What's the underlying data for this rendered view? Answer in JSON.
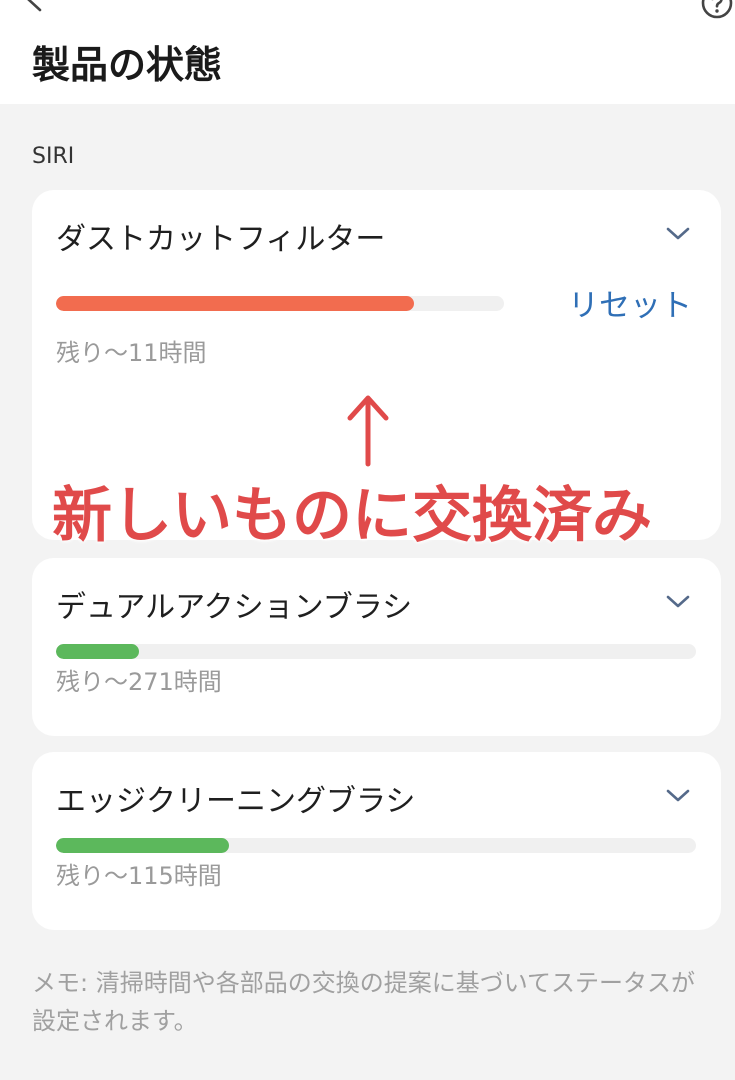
{
  "header": {
    "title": "製品の状態",
    "back_icon": "chevron-left-icon",
    "help_icon": "question-circle-icon"
  },
  "section": {
    "label": "SIRI"
  },
  "parts": [
    {
      "name": "ダストカットフィルター",
      "remaining": "残り〜11時間",
      "progress": 0.8,
      "color": "#f26c4f",
      "reset_label": "リセット"
    },
    {
      "name": "デュアルアクションブラシ",
      "remaining": "残り〜271時間",
      "progress": 0.13,
      "color": "#5cb85c"
    },
    {
      "name": "エッジクリーニングブラシ",
      "remaining": "残り〜115時間",
      "progress": 0.27,
      "color": "#5cb85c"
    }
  ],
  "annotation": {
    "arrow": "↑",
    "text": "新しいものに交換済み",
    "color": "#e04a4a"
  },
  "memo": "メモ: 清掃時間や各部品の交換の提案に基づいてステータスが設定されます。",
  "colors": {
    "accent_link": "#2f6fb6",
    "background": "#f3f3f3",
    "card": "#ffffff"
  }
}
